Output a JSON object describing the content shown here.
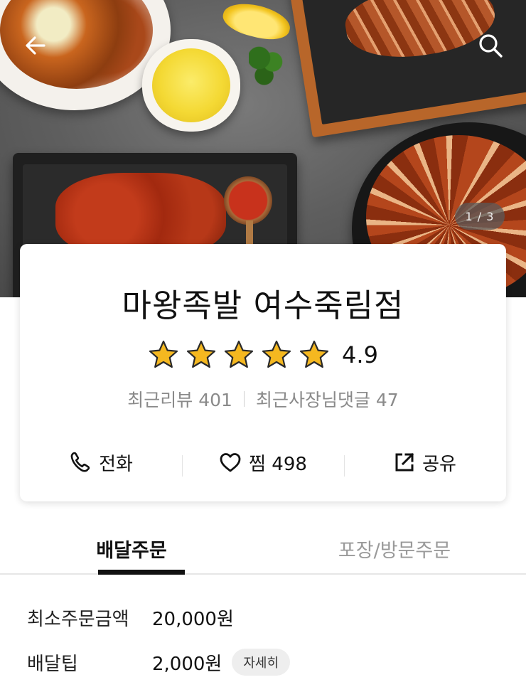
{
  "hero": {
    "image_counter": "1 / 3",
    "icons": {
      "back": "back-arrow-icon",
      "search": "search-icon"
    }
  },
  "store": {
    "name": "마왕족발 여수죽림점",
    "rating": "4.9",
    "stars": 5,
    "star_color": "#f5b820",
    "recent_reviews": "최근리뷰 401",
    "owner_comments": "최근사장님댓글 47"
  },
  "actions": {
    "call": {
      "label": "전화",
      "icon": "phone-icon"
    },
    "favorite": {
      "label": "찜 498",
      "icon": "heart-icon"
    },
    "share": {
      "label": "공유",
      "icon": "share-icon"
    }
  },
  "tabs": [
    {
      "label": "배달주문",
      "active": true
    },
    {
      "label": "포장/방문주문",
      "active": false
    }
  ],
  "delivery": {
    "min_order_label": "최소주문금액",
    "min_order_value": "20,000원",
    "tip_label": "배달팁",
    "tip_value": "2,000원",
    "detail_button": "자세히"
  }
}
